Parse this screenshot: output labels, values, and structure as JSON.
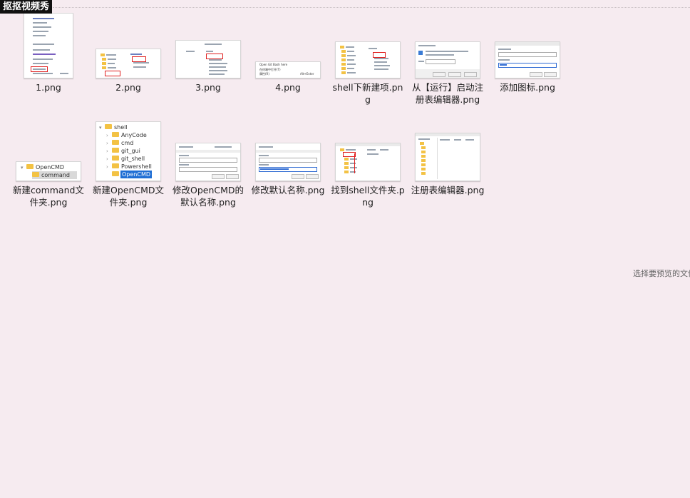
{
  "header": {
    "watermark": "抠抠视频秀"
  },
  "files": [
    {
      "name": "1.png"
    },
    {
      "name": "2.png"
    },
    {
      "name": "3.png"
    },
    {
      "name": "4.png"
    },
    {
      "name": "shell下新建项.png"
    },
    {
      "name": "从【运行】启动注册表编辑器.png"
    },
    {
      "name": "添加图标.png"
    },
    {
      "name": "新建command文件夹.png"
    },
    {
      "name": "新建OpenCMD文件夹.png"
    },
    {
      "name": "修改OpenCMD的默认名称.png"
    },
    {
      "name": "修改默认名称.png"
    },
    {
      "name": "找到shell文件夹.png"
    },
    {
      "name": "注册表编辑器.png"
    }
  ],
  "thumb_text": {
    "t1_opencmd": "OpenCMD",
    "t1_vs": "通过 Visual Studio 打开(V)",
    "t1_git": "Open Git GUI here",
    "t4_git": "Open Git Bash here",
    "t4_terminal": "在终端中打开(T)",
    "t4_props": "属性(R)",
    "t4_shortcut": "Alt+Enter",
    "t8_opencmd": "OpenCMD",
    "t8_command": "command",
    "t9_tree": [
      "shell",
      "AnyCode",
      "cmd",
      "git_gui",
      "git_shell",
      "Powershell"
    ],
    "t9_editing": "OpenCMD"
  },
  "preview_pane": {
    "hint": "选择要预览的文件。"
  }
}
